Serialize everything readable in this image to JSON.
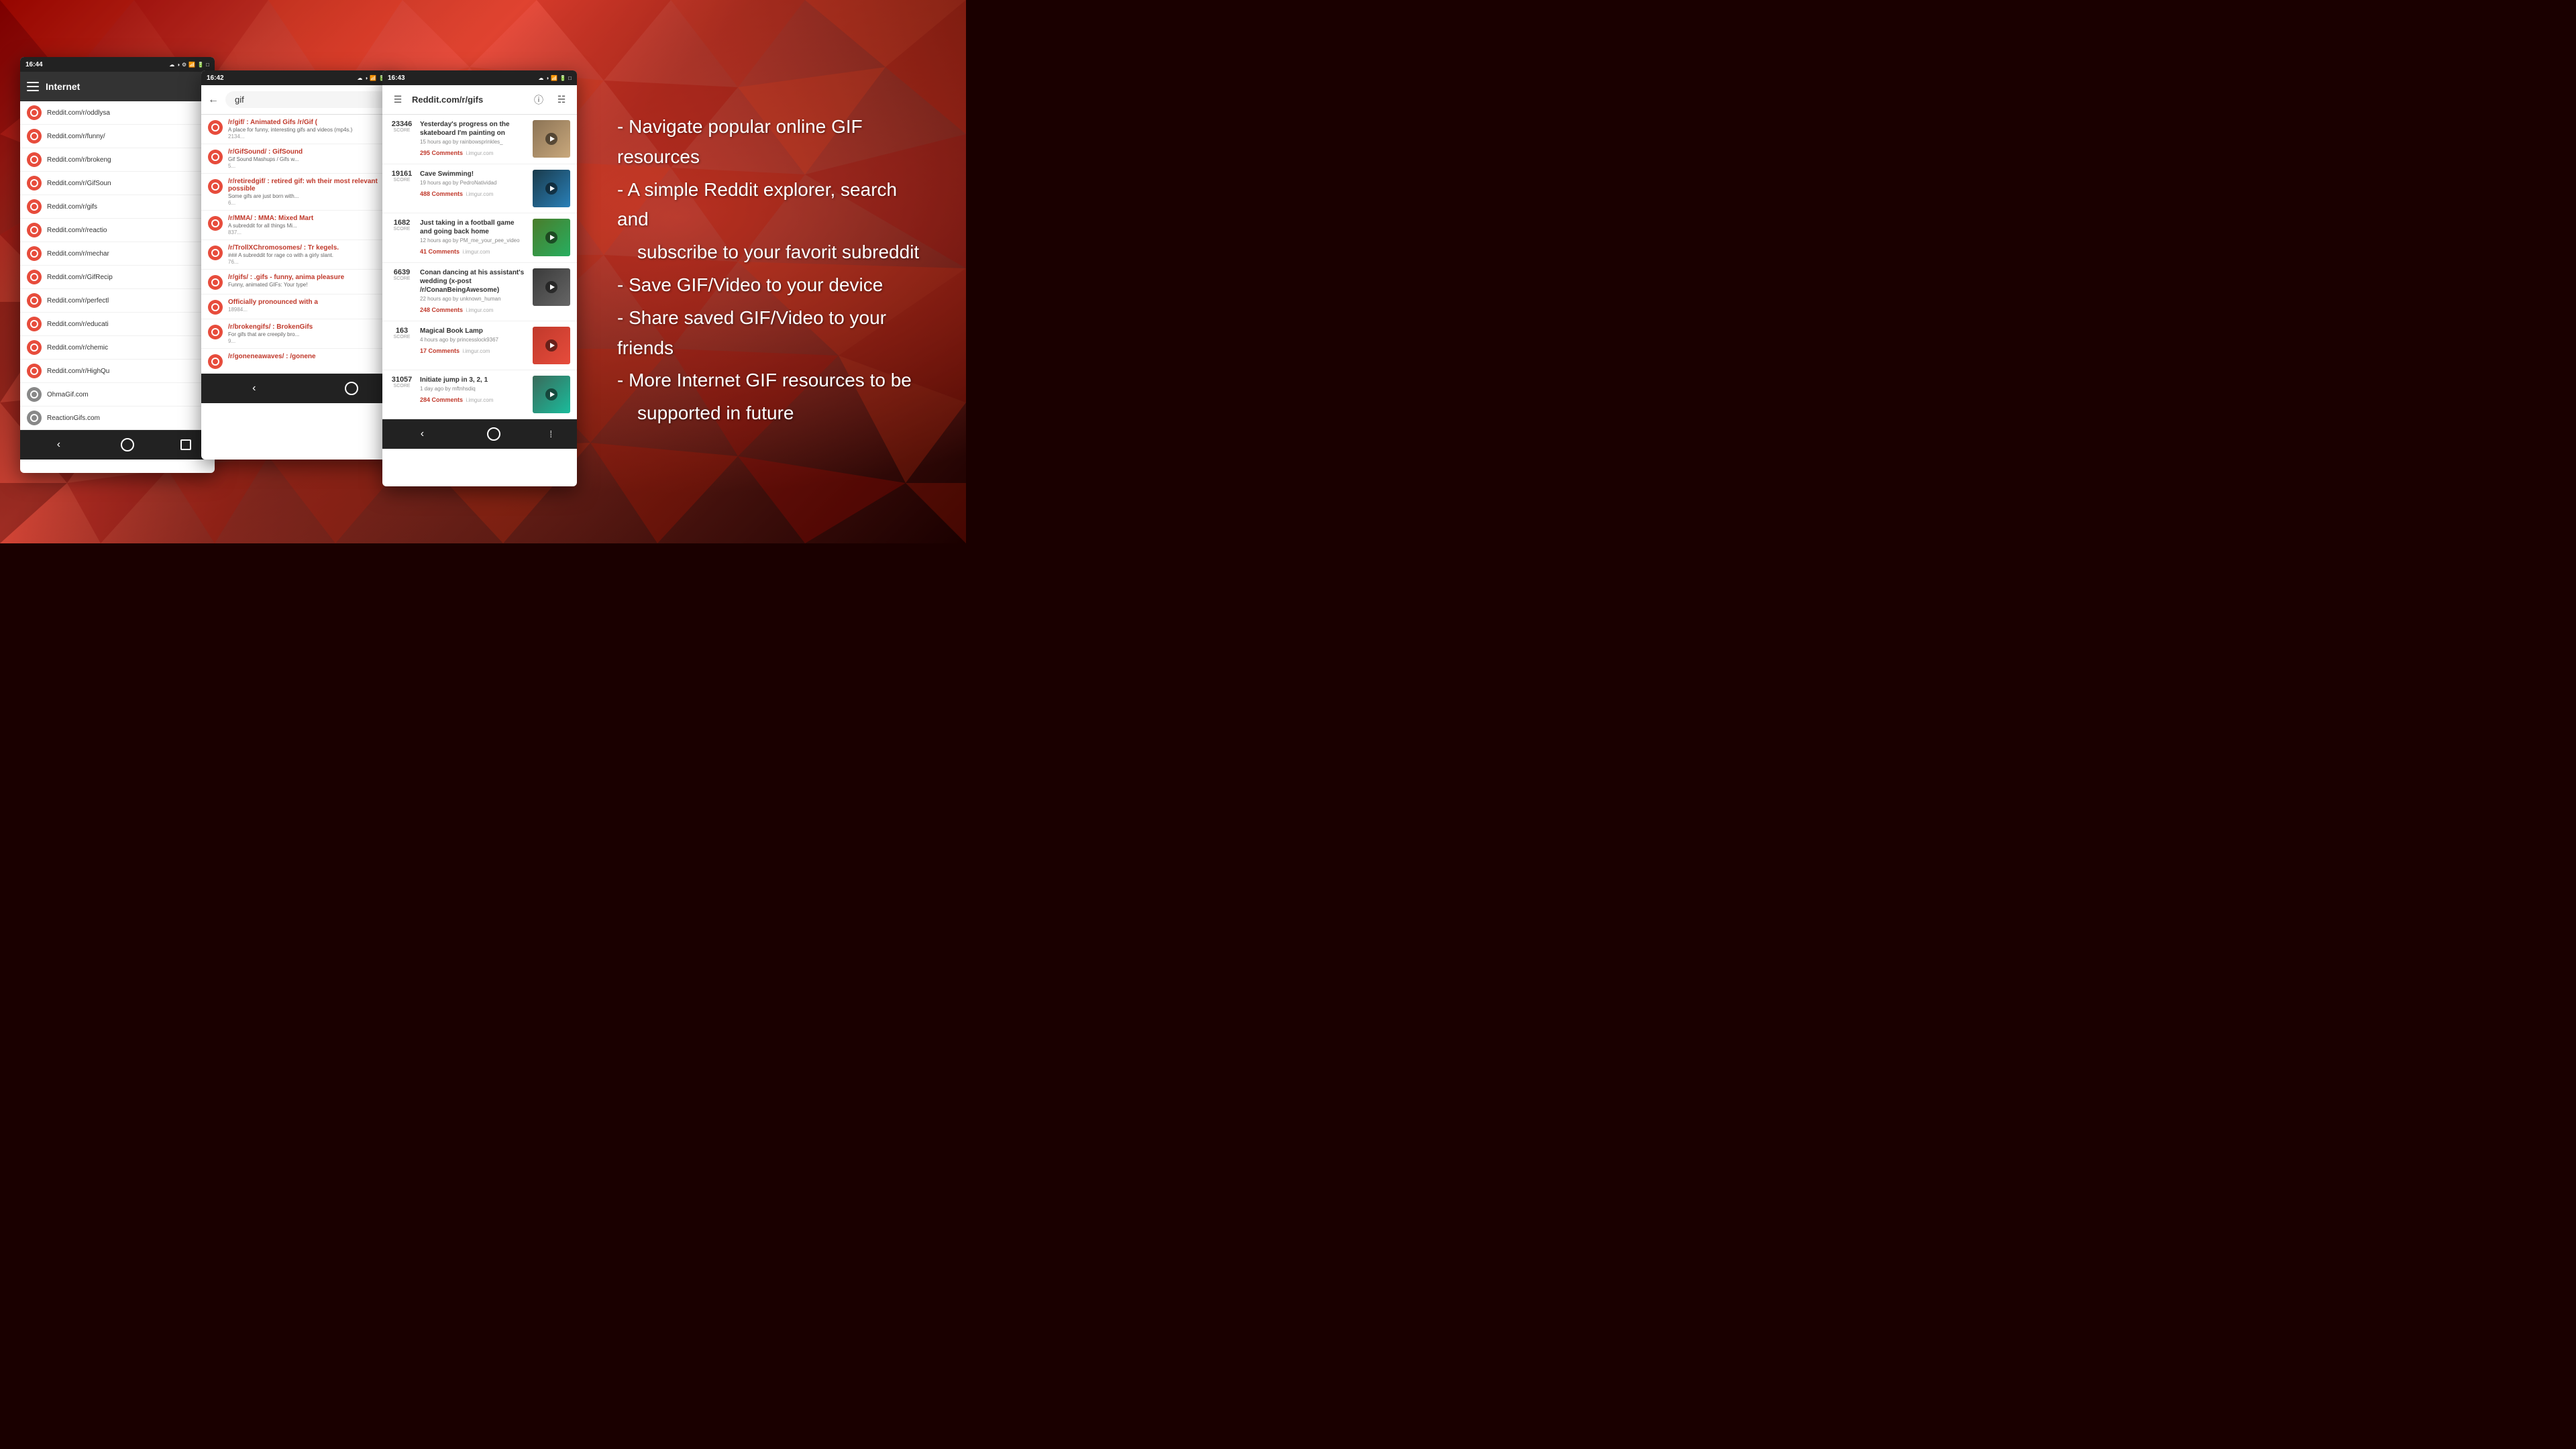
{
  "background": {
    "colors": [
      "#8b0000",
      "#c0392b",
      "#e74c3c",
      "#1a0000"
    ]
  },
  "phone1": {
    "status_bar": {
      "time": "16:44",
      "icons": "☁ ◑ ⚙ 🔋 □"
    },
    "app_bar_title": "Internet",
    "items": [
      {
        "url": "Reddit.com/r/oddlysa",
        "icon": "reddit"
      },
      {
        "url": "Reddit.com/r/funny/",
        "icon": "reddit"
      },
      {
        "url": "Reddit.com/r/brokeng",
        "icon": "reddit"
      },
      {
        "url": "Reddit.com/r/GifSoun",
        "icon": "reddit"
      },
      {
        "url": "Reddit.com/r/gifs",
        "icon": "reddit"
      },
      {
        "url": "Reddit.com/r/reactio",
        "icon": "reddit"
      },
      {
        "url": "Reddit.com/r/mechar",
        "icon": "reddit"
      },
      {
        "url": "Reddit.com/r/GifRecip",
        "icon": "reddit"
      },
      {
        "url": "Reddit.com/r/perfectl",
        "icon": "reddit"
      },
      {
        "url": "Reddit.com/r/educati",
        "icon": "reddit"
      },
      {
        "url": "Reddit.com/r/chemic",
        "icon": "reddit"
      },
      {
        "url": "Reddit.com/r/HighQu",
        "icon": "reddit"
      },
      {
        "url": "OhmaGif.com",
        "icon": "web"
      },
      {
        "url": "ReactionGifs.com",
        "icon": "web"
      }
    ]
  },
  "phone2": {
    "status_bar": {
      "time": "16:42",
      "icons": "☁ ◑ 🔋 □"
    },
    "search_value": "gif",
    "search_placeholder": "gif",
    "results": [
      {
        "title": "/r/gif/ : Animated Gifs /r/Gif (",
        "desc": "A place for funny, interesting gifs and videos (mp4s.)",
        "count": "2134..."
      },
      {
        "title": "/r/GifSound/ : GifSound",
        "desc": "Gif Sound Mashups / Gifs w...",
        "count": "5..."
      },
      {
        "title": "/r/retiredgif/ : retired gif: wh their most relevant possible",
        "desc": "Some gifs are just born with...",
        "count": "6..."
      },
      {
        "title": "/r/MMA/ : MMA: Mixed Mart",
        "desc": "A subreddit for all things Mi...",
        "count": "837..."
      },
      {
        "title": "/r/TrollXChromosomes/ : Tr kegels.",
        "desc": "### A subreddit for rage co with a girly slant.",
        "count": "76..."
      },
      {
        "title": "/r/gifs/ : .gifs - funny, anima pleasure",
        "desc": "Funny, animated GIFs: Your type!",
        "count": ""
      },
      {
        "title": "Officially pronounced with a",
        "desc": "",
        "count": "18984..."
      },
      {
        "title": "/r/brokengifs/ : BrokenGifs",
        "desc": "For gifs that are creepily bro...",
        "count": "9..."
      },
      {
        "title": "/r/goneneawaves/ : /gonene",
        "desc": "",
        "count": ""
      }
    ]
  },
  "phone3": {
    "status_bar": {
      "time": "16:43",
      "icons": "☁ ◑ 🔋 □"
    },
    "subreddit": "Reddit.com/r/gifs",
    "posts": [
      {
        "score": "23346",
        "score_label": "SCORE",
        "title": "Yesterday's progress on the skateboard I'm painting on",
        "meta": "15 hours ago by rainbowsprinkles_",
        "comments": "295 Comments",
        "source": "i.imgur.com",
        "thumb_class": "thumb-1"
      },
      {
        "score": "19161",
        "score_label": "SCORE",
        "title": "Cave Swimming!",
        "meta": "19 hours ago by PedroNatividad",
        "comments": "488 Comments",
        "source": "i.imgur.com",
        "thumb_class": "thumb-2"
      },
      {
        "score": "1682",
        "score_label": "SCORE",
        "title": "Just taking in a football game and going back home",
        "meta": "12 hours ago by PM_me_your_pee_video",
        "comments": "41 Comments",
        "source": "i.imgur.com",
        "thumb_class": "thumb-3"
      },
      {
        "score": "6639",
        "score_label": "SCORE",
        "title": "Conan dancing at his assistant's wedding (x-post /r/ConanBeingAwesome)",
        "meta": "22 hours ago by unknown_human",
        "comments": "248 Comments",
        "source": "i.imgur.com",
        "thumb_class": "thumb-4"
      },
      {
        "score": "163",
        "score_label": "SCORE",
        "title": "Magical Book Lamp",
        "meta": "4 hours ago by princesslock9367",
        "comments": "17 Comments",
        "source": "i.imgur.com",
        "thumb_class": "thumb-5"
      },
      {
        "score": "31057",
        "score_label": "SCORE",
        "title": "Initiate jump in 3, 2, 1",
        "meta": "1 day ago by mftnhsdiq",
        "comments": "284 Comments",
        "source": "i.imgur.com",
        "thumb_class": "thumb-7"
      }
    ]
  },
  "features": {
    "lines": [
      "- Navigate popular online GIF resources",
      "- A simple Reddit explorer, search and",
      "   subscribe to your favorit subreddit",
      "- Save GIF/Video to your device",
      "- Share saved GIF/Video to your friends",
      "- More Internet GIF resources to be",
      "   supported in future"
    ]
  }
}
